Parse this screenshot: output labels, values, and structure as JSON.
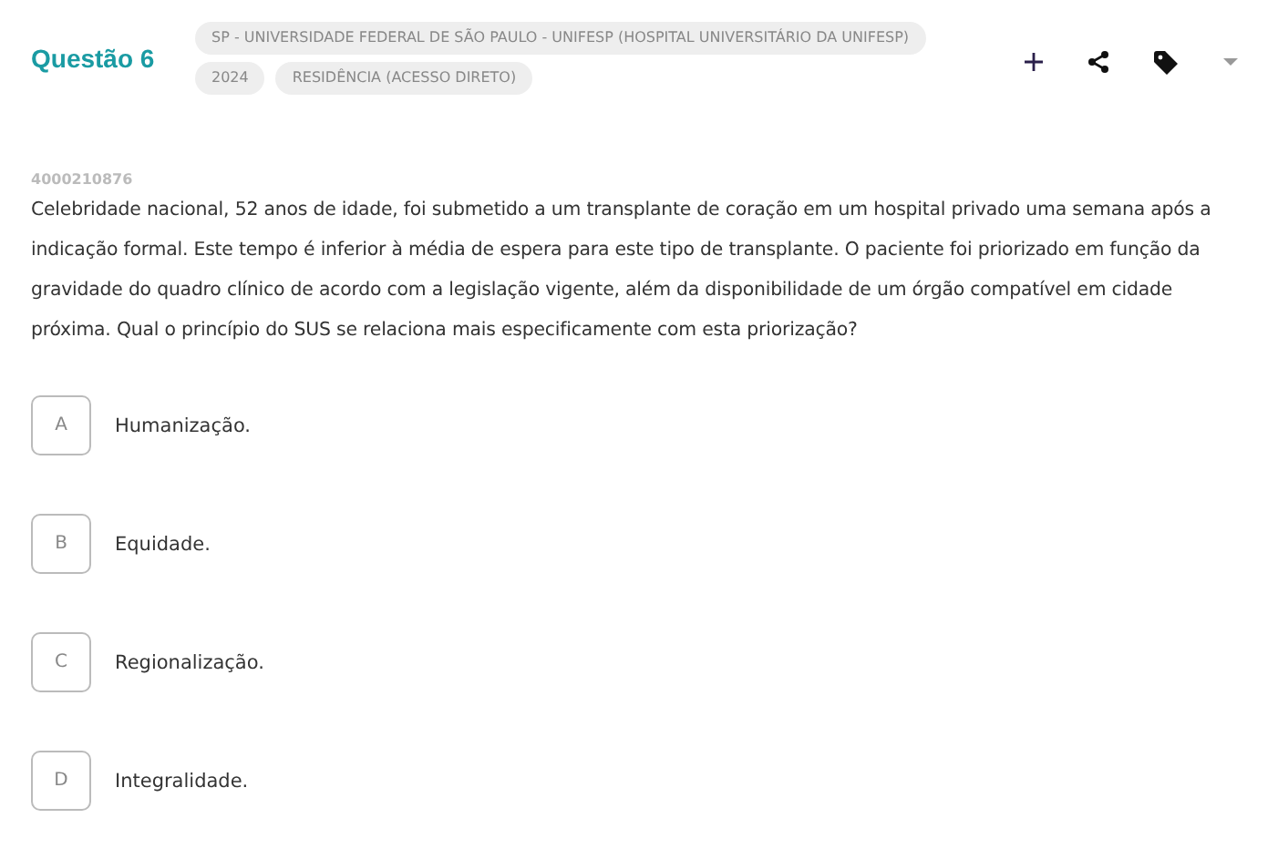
{
  "question": {
    "title": "Questão 6",
    "tags": [
      [
        "SP - UNIVERSIDADE FEDERAL DE SÃO PAULO - UNIFESP (HOSPITAL UNIVERSITÁRIO DA UNIFESP)"
      ],
      [
        "2024",
        "RESIDÊNCIA (ACESSO DIRETO)"
      ]
    ],
    "id": "4000210876",
    "text": "Celebridade nacional, 52 anos de idade, foi submetido a um transplante de coração em um hospital privado uma semana após a indicação formal. Este tempo é inferior à média de espera para este tipo de transplante. O paciente foi priorizado em função da gravidade do quadro clínico de acordo com a legislação vigente, além da disponibilidade de um órgão compatível em cidade próxima. Qual o princípio do SUS se relaciona mais especificamente com esta priorização?",
    "options": [
      {
        "letter": "A",
        "text": "Humanização."
      },
      {
        "letter": "B",
        "text": "Equidade."
      },
      {
        "letter": "C",
        "text": "Regionalização."
      },
      {
        "letter": "D",
        "text": "Integralidade."
      }
    ]
  }
}
